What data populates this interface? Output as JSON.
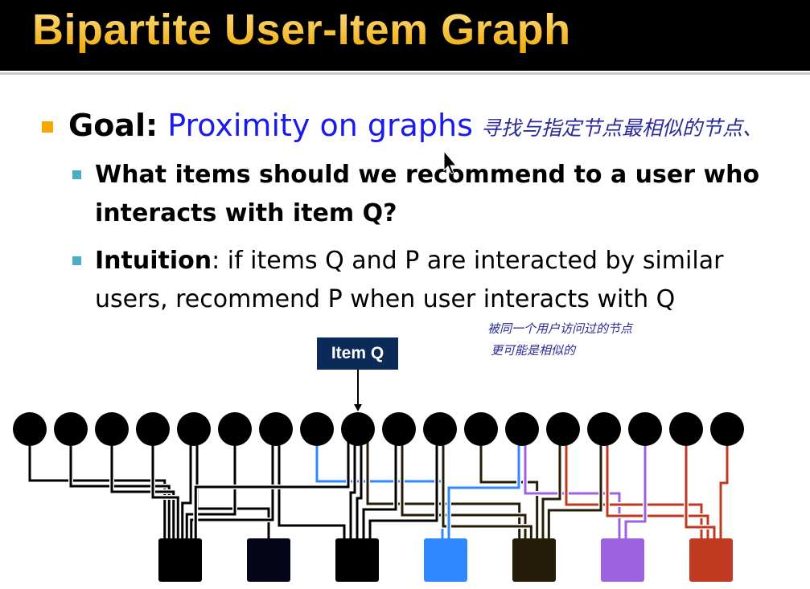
{
  "slide": {
    "title": "Bipartite User-Item Graph",
    "goal_label": "Goal:",
    "goal_text": "Proximity on graphs",
    "bullet1_line1": "What items should we recommend to a user who",
    "bullet1_line2": "interacts with item Q?",
    "bullet2_bold": "Intuition",
    "bullet2_line1": ": if items Q and P are interacted by similar",
    "bullet2_line2": "users, recommend P when user interacts with Q"
  },
  "annotations": {
    "note1": "寻找与指定节点最相似的节点、",
    "note2_line1": "被同一个用户访问过的节点",
    "note2_line2": "更可能是相似的"
  },
  "diagram": {
    "query_label": "Item Q",
    "query_item_index": 8,
    "item_count": 18,
    "users": [
      {
        "color": "#000000"
      },
      {
        "color": "#05051a"
      },
      {
        "color": "#000000"
      },
      {
        "color": "#2f88ff"
      },
      {
        "color": "#261d08"
      },
      {
        "color": "#9d63de"
      },
      {
        "color": "#bf3a20"
      }
    ],
    "edges": [
      [
        0,
        0,
        "#000000"
      ],
      [
        1,
        0,
        "#000000"
      ],
      [
        2,
        0,
        "#000000"
      ],
      [
        3,
        0,
        "#000000"
      ],
      [
        4,
        0,
        "#000000"
      ],
      [
        4,
        1,
        "#000000"
      ],
      [
        5,
        0,
        "#000000"
      ],
      [
        6,
        0,
        "#000000"
      ],
      [
        6,
        2,
        "#000000"
      ],
      [
        7,
        3,
        "#2f88ff"
      ],
      [
        8,
        0,
        "#000000"
      ],
      [
        8,
        2,
        "#000000"
      ],
      [
        8,
        2,
        "#000000"
      ],
      [
        8,
        4,
        "#261d08"
      ],
      [
        9,
        2,
        "#000000"
      ],
      [
        9,
        4,
        "#261d08"
      ],
      [
        10,
        2,
        "#000000"
      ],
      [
        10,
        4,
        "#261d08"
      ],
      [
        11,
        4,
        "#261d08"
      ],
      [
        12,
        3,
        "#2f88ff"
      ],
      [
        12,
        5,
        "#9d63de"
      ],
      [
        13,
        4,
        "#261d08"
      ],
      [
        13,
        6,
        "#bf3a20"
      ],
      [
        14,
        4,
        "#261d08"
      ],
      [
        14,
        6,
        "#bf3a20"
      ],
      [
        15,
        5,
        "#9d63de"
      ],
      [
        16,
        6,
        "#bf3a20"
      ],
      [
        17,
        6,
        "#bf3a20"
      ]
    ]
  }
}
